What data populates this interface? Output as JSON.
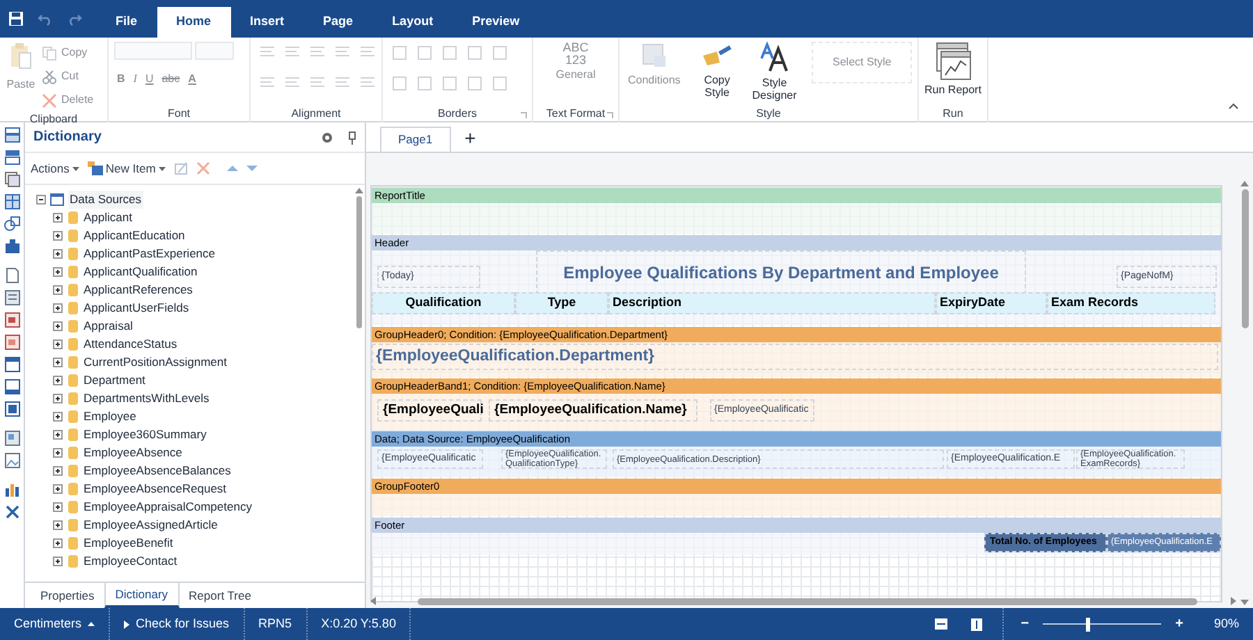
{
  "menu_tabs": [
    {
      "label": "File",
      "selected": false
    },
    {
      "label": "Home",
      "selected": true
    },
    {
      "label": "Insert",
      "selected": false
    },
    {
      "label": "Page",
      "selected": false
    },
    {
      "label": "Layout",
      "selected": false
    },
    {
      "label": "Preview",
      "selected": false
    }
  ],
  "ribbon": {
    "groups": [
      {
        "kind": "clipboard",
        "title": "Clipboard",
        "items": [
          {
            "label": "Paste",
            "disabled": true
          },
          {
            "label": "Copy",
            "disabled": true
          },
          {
            "label": "Cut",
            "disabled": true
          },
          {
            "label": "Delete",
            "disabled": true
          }
        ]
      },
      {
        "kind": "font",
        "title": "Font",
        "items": [
          {
            "label": "B",
            "disabled": true
          },
          {
            "label": "I",
            "disabled": true
          },
          {
            "label": "U",
            "disabled": true
          },
          {
            "label": "abc",
            "disabled": true
          },
          {
            "label": "A",
            "disabled": true
          }
        ]
      },
      {
        "kind": "alignment",
        "title": "Alignment"
      },
      {
        "kind": "borders",
        "title": "Borders"
      },
      {
        "kind": "text_format",
        "title": "Text Format",
        "sample_lines": [
          "ABC",
          "123"
        ],
        "value": "General"
      },
      {
        "kind": "style",
        "title": "Style",
        "items": [
          {
            "label": "Conditions",
            "disabled": true
          },
          {
            "label": "Copy Style",
            "disabled": false
          },
          {
            "label": "Style Designer",
            "disabled": false
          }
        ],
        "select": {
          "placeholder": "Select Style"
        }
      },
      {
        "kind": "run",
        "title": "Run",
        "items": [
          {
            "label": "Run Report",
            "disabled": false
          }
        ]
      }
    ]
  },
  "dictionary": {
    "title": "Dictionary",
    "toolbar": [
      "Actions",
      "New Item"
    ],
    "tree": {
      "label": "Data Sources",
      "expanded": true,
      "selected": true,
      "children": [
        {
          "label": "Applicant",
          "expanded": false
        },
        {
          "label": "ApplicantEducation",
          "expanded": false
        },
        {
          "label": "ApplicantPastExperience",
          "expanded": false
        },
        {
          "label": "ApplicantQualification",
          "expanded": false
        },
        {
          "label": "ApplicantReferences",
          "expanded": false
        },
        {
          "label": "ApplicantUserFields",
          "expanded": false
        },
        {
          "label": "Appraisal",
          "expanded": false
        },
        {
          "label": "AttendanceStatus",
          "expanded": false
        },
        {
          "label": "CurrentPositionAssignment",
          "expanded": false
        },
        {
          "label": "Department",
          "expanded": false
        },
        {
          "label": "DepartmentsWithLevels",
          "expanded": false
        },
        {
          "label": "Employee",
          "expanded": false
        },
        {
          "label": "Employee360Summary",
          "expanded": false
        },
        {
          "label": "EmployeeAbsence",
          "expanded": false
        },
        {
          "label": "EmployeeAbsenceBalances",
          "expanded": false
        },
        {
          "label": "EmployeeAbsenceRequest",
          "expanded": false
        },
        {
          "label": "EmployeeAppraisalCompetency",
          "expanded": false
        },
        {
          "label": "EmployeeAssignedArticle",
          "expanded": false
        },
        {
          "label": "EmployeeBenefit",
          "expanded": false
        },
        {
          "label": "EmployeeContact",
          "expanded": false
        }
      ]
    },
    "tabs": [
      {
        "label": "Properties",
        "selected": false
      },
      {
        "label": "Dictionary",
        "selected": true
      },
      {
        "label": "Report Tree",
        "selected": false
      }
    ]
  },
  "page_tabs": [
    {
      "label": "Page1",
      "selected": true
    }
  ],
  "add_page": "+",
  "bands": [
    {
      "kind": "report_title",
      "title": "ReportTitle"
    },
    {
      "kind": "header",
      "title": "Header",
      "components": [
        {
          "kind": "field",
          "text": "{Today}"
        },
        {
          "kind": "title",
          "text": "Employee Qualifications By Department and Employee"
        },
        {
          "kind": "field",
          "text": "{PageNofM}"
        },
        {
          "kind": "column_header",
          "text": "Qualification"
        },
        {
          "kind": "column_header",
          "text": "Type"
        },
        {
          "kind": "column_header",
          "text": "Description"
        },
        {
          "kind": "column_header",
          "text": "ExpiryDate"
        },
        {
          "kind": "column_header",
          "text": "Exam Records"
        }
      ]
    },
    {
      "kind": "group_header",
      "title": "GroupHeader0; Condition: {EmployeeQualification.Department}",
      "components": [
        {
          "kind": "field_large",
          "text": "{EmployeeQualification.Department}"
        }
      ]
    },
    {
      "kind": "group_header",
      "title": "GroupHeaderBand1; Condition: {EmployeeQualification.Name}",
      "components": [
        {
          "kind": "field_bold",
          "text": "{EmployeeQuali"
        },
        {
          "kind": "field_bold",
          "text": "{EmployeeQualification.Name}"
        },
        {
          "kind": "field",
          "text": "{EmployeeQualificatic"
        }
      ]
    },
    {
      "kind": "data",
      "title": "Data; Data Source: EmployeeQualification",
      "components": [
        {
          "kind": "field",
          "text": "{EmployeeQualificatic"
        },
        {
          "kind": "field_small",
          "text": "{EmployeeQualification. QualificationType}"
        },
        {
          "kind": "field_small",
          "text": "{EmployeeQualification.Description}"
        },
        {
          "kind": "field",
          "text": "{EmployeeQualification.E"
        },
        {
          "kind": "field_small",
          "text": "{EmployeeQualification. ExamRecords}"
        }
      ]
    },
    {
      "kind": "group_footer",
      "title": "GroupFooter0"
    },
    {
      "kind": "footer",
      "title": "Footer",
      "components": [
        {
          "kind": "total",
          "text": "Total No. of Employees"
        },
        {
          "kind": "total_value",
          "text": "(EmployeeQualification.E"
        }
      ]
    }
  ],
  "status_bar": {
    "units": "Centimeters",
    "check": "Check for Issues",
    "engine": "RPN5",
    "position": "X:0.20 Y:5.80",
    "zoom_minus": "−",
    "zoom_plus": "+",
    "zoom": {
      "level": 0.36
    },
    "zoom_text": "90%"
  }
}
